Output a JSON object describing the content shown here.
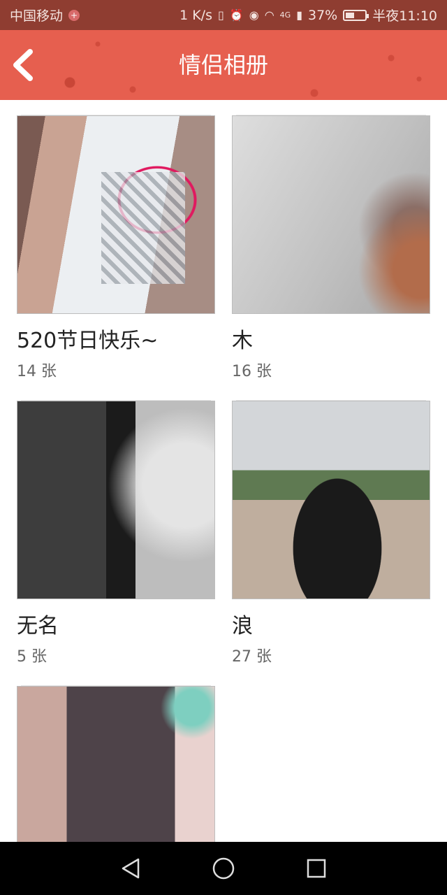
{
  "status_bar": {
    "carrier": "中国移动",
    "carrier_badge": "+",
    "speed": "1 K/s",
    "network": "4G",
    "battery": "37%",
    "time": "半夜11:10"
  },
  "header": {
    "title": "情侣相册"
  },
  "albums": [
    {
      "name": "520节日快乐~",
      "count": "14 张"
    },
    {
      "name": "木",
      "count": "16 张"
    },
    {
      "name": "无名",
      "count": "5 张"
    },
    {
      "name": "浪",
      "count": "27 张"
    },
    {
      "name": "",
      "count": ""
    }
  ],
  "colors": {
    "status_bar": "#8f3d31",
    "title_bar": "#e65f4f",
    "nav_bar": "#000000"
  },
  "icons": {
    "back": "chevron-left-icon",
    "nav_back": "triangle-back-icon",
    "nav_home": "circle-home-icon",
    "nav_recent": "square-recent-icon"
  }
}
